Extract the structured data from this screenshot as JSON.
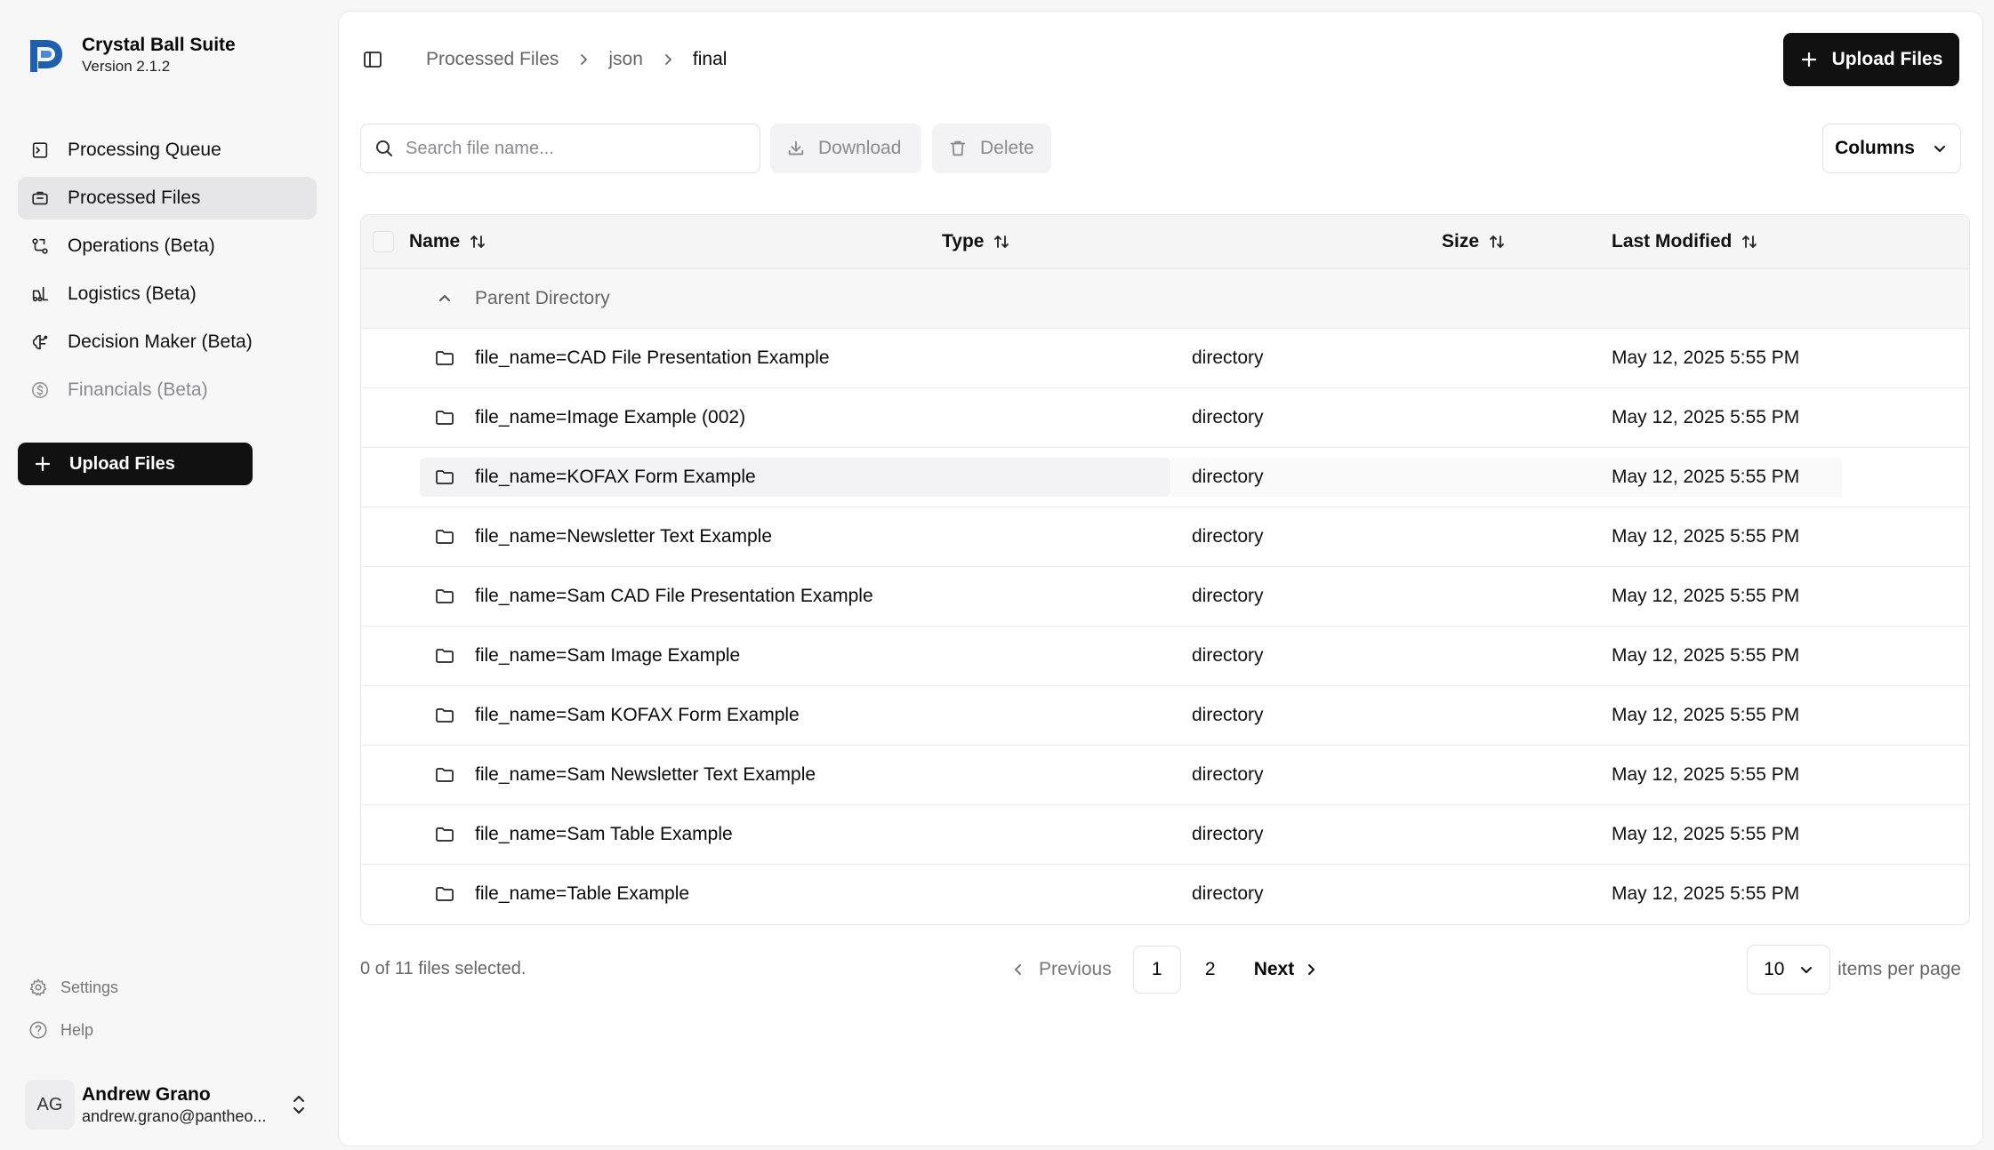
{
  "app": {
    "name": "Crystal Ball Suite",
    "version": "Version 2.1.2"
  },
  "sidebar": {
    "nav": [
      {
        "label": "Processing Queue",
        "icon": "queue-icon",
        "state": "normal"
      },
      {
        "label": "Processed Files",
        "icon": "briefcase-icon",
        "state": "active"
      },
      {
        "label": "Operations (Beta)",
        "icon": "workflow-icon",
        "state": "normal"
      },
      {
        "label": "Logistics (Beta)",
        "icon": "forklift-icon",
        "state": "normal"
      },
      {
        "label": "Decision Maker (Beta)",
        "icon": "brain-icon",
        "state": "normal"
      },
      {
        "label": "Financials (Beta)",
        "icon": "dollar-circle-icon",
        "state": "disabled"
      }
    ],
    "upload_label": "Upload Files",
    "settings_label": "Settings",
    "help_label": "Help",
    "user": {
      "initials": "AG",
      "name": "Andrew Grano",
      "email": "andrew.grano@pantheo..."
    }
  },
  "header": {
    "breadcrumb": [
      "Processed Files",
      "json",
      "final"
    ],
    "upload_label": "Upload Files"
  },
  "toolbar": {
    "search_placeholder": "Search file name...",
    "download_label": "Download",
    "delete_label": "Delete",
    "columns_label": "Columns"
  },
  "table": {
    "headers": {
      "name": "Name",
      "type": "Type",
      "size": "Size",
      "modified": "Last Modified"
    },
    "parent_label": "Parent Directory",
    "rows": [
      {
        "name": "file_name=CAD File Presentation Example",
        "type": "directory",
        "size": "",
        "modified": "May 12, 2025 5:55 PM"
      },
      {
        "name": "file_name=Image Example (002)",
        "type": "directory",
        "size": "",
        "modified": "May 12, 2025 5:55 PM"
      },
      {
        "name": "file_name=KOFAX Form Example",
        "type": "directory",
        "size": "",
        "modified": "May 12, 2025 5:55 PM"
      },
      {
        "name": "file_name=Newsletter Text Example",
        "type": "directory",
        "size": "",
        "modified": "May 12, 2025 5:55 PM"
      },
      {
        "name": "file_name=Sam CAD File Presentation Example",
        "type": "directory",
        "size": "",
        "modified": "May 12, 2025 5:55 PM"
      },
      {
        "name": "file_name=Sam Image Example",
        "type": "directory",
        "size": "",
        "modified": "May 12, 2025 5:55 PM"
      },
      {
        "name": "file_name=Sam KOFAX Form Example",
        "type": "directory",
        "size": "",
        "modified": "May 12, 2025 5:55 PM"
      },
      {
        "name": "file_name=Sam Newsletter Text Example",
        "type": "directory",
        "size": "",
        "modified": "May 12, 2025 5:55 PM"
      },
      {
        "name": "file_name=Sam Table Example",
        "type": "directory",
        "size": "",
        "modified": "May 12, 2025 5:55 PM"
      },
      {
        "name": "file_name=Table Example",
        "type": "directory",
        "size": "",
        "modified": "May 12, 2025 5:55 PM"
      }
    ]
  },
  "footer": {
    "selection_text": "0 of 11 files selected.",
    "previous_label": "Previous",
    "pages": [
      "1",
      "2"
    ],
    "current_page": "1",
    "next_label": "Next",
    "per_page_value": "10",
    "per_page_label": "items per page"
  },
  "colors": {
    "primary_button": "#111111",
    "active_nav_bg": "#e6e6e8",
    "brand_blue": "#1f5fb0"
  }
}
